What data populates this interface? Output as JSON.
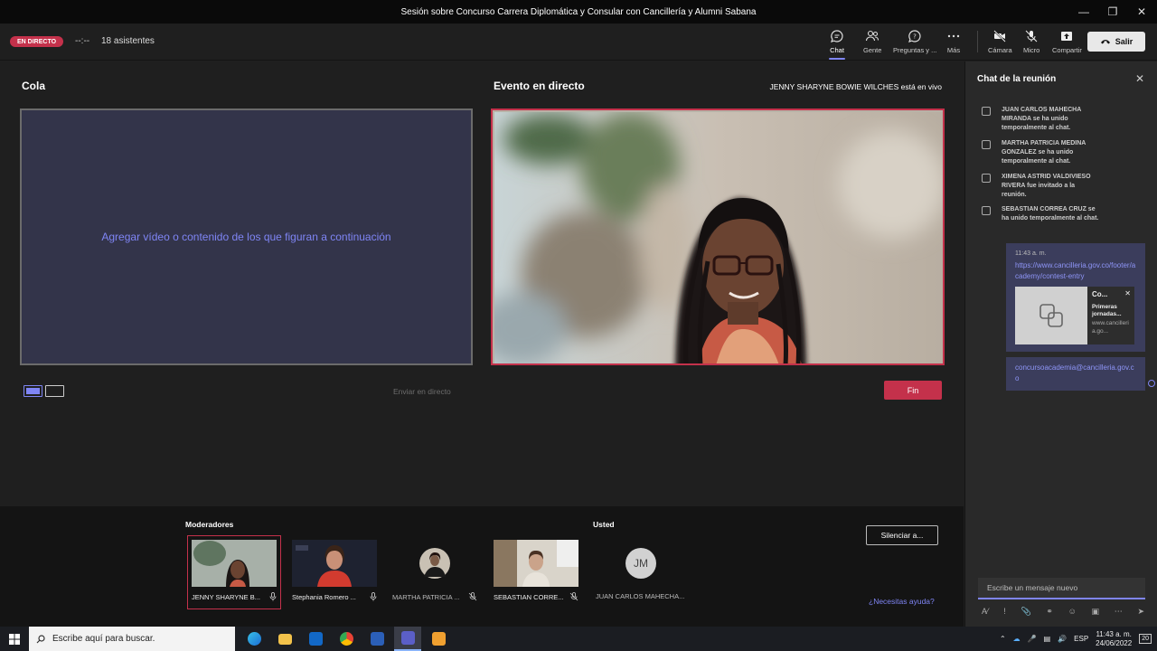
{
  "window": {
    "title": "Sesión sobre Concurso Carrera Diplomática y Consular con Cancillería y Alumni Sabana"
  },
  "topbar": {
    "live_badge": "EN DIRECTO",
    "timer": "--:--",
    "attendees": "18 asistentes",
    "chat_label": "Chat",
    "people_label": "Gente",
    "qa_label": "Preguntas y ...",
    "more_label": "Más",
    "camera_label": "Cámara",
    "mic_label": "Micro",
    "share_label": "Compartir",
    "leave_label": "Salir"
  },
  "stage": {
    "queue_title": "Cola",
    "queue_placeholder": "Agregar vídeo o contenido de los que figuran a continuación",
    "live_title": "Evento en directo",
    "live_status": "JENNY SHARYNE BOWIE WILCHES está en vivo",
    "send_live": "Enviar en directo",
    "end_label": "Fin"
  },
  "participants": {
    "moderators_label": "Moderadores",
    "you_label": "Usted",
    "mute_all": "Silenciar a...",
    "help": "¿Necesitas ayuda?",
    "tiles": [
      {
        "name": "JENNY SHARYNE B..."
      },
      {
        "name": "Stephania Romero ..."
      },
      {
        "name": "MARTHA PATRICIA ..."
      },
      {
        "name": "SEBASTIAN CORRE..."
      },
      {
        "name": "JUAN CARLOS MAHECHA...",
        "initials": "JM"
      }
    ]
  },
  "chat": {
    "title": "Chat de la reunión",
    "system_messages": [
      "JUAN CARLOS MAHECHA MIRANDA se ha unido temporalmente al chat.",
      "MARTHA PATRICIA MEDINA GONZALEZ se ha unido temporalmente al chat.",
      "XIMENA ASTRID VALDIVIESO RIVERA fue invitado a la reunión.",
      "SEBASTIAN CORREA CRUZ se ha unido temporalmente al chat."
    ],
    "message": {
      "time": "11:43 a. m.",
      "link": "https://www.cancilleria.gov.co/footer/academy/contest-entry",
      "card_title": "Co...",
      "card_desc": "Primeras jornadas...",
      "card_domain": "www.cancilleria.go...",
      "email": "concursoacademia@cancilleria.gov.co"
    },
    "compose_placeholder": "Escribe un mensaje nuevo"
  },
  "taskbar": {
    "search_placeholder": "Escribe aquí para buscar.",
    "lang": "ESP",
    "time": "11:43 a. m.",
    "date": "24/06/2022",
    "notifications": "20"
  }
}
